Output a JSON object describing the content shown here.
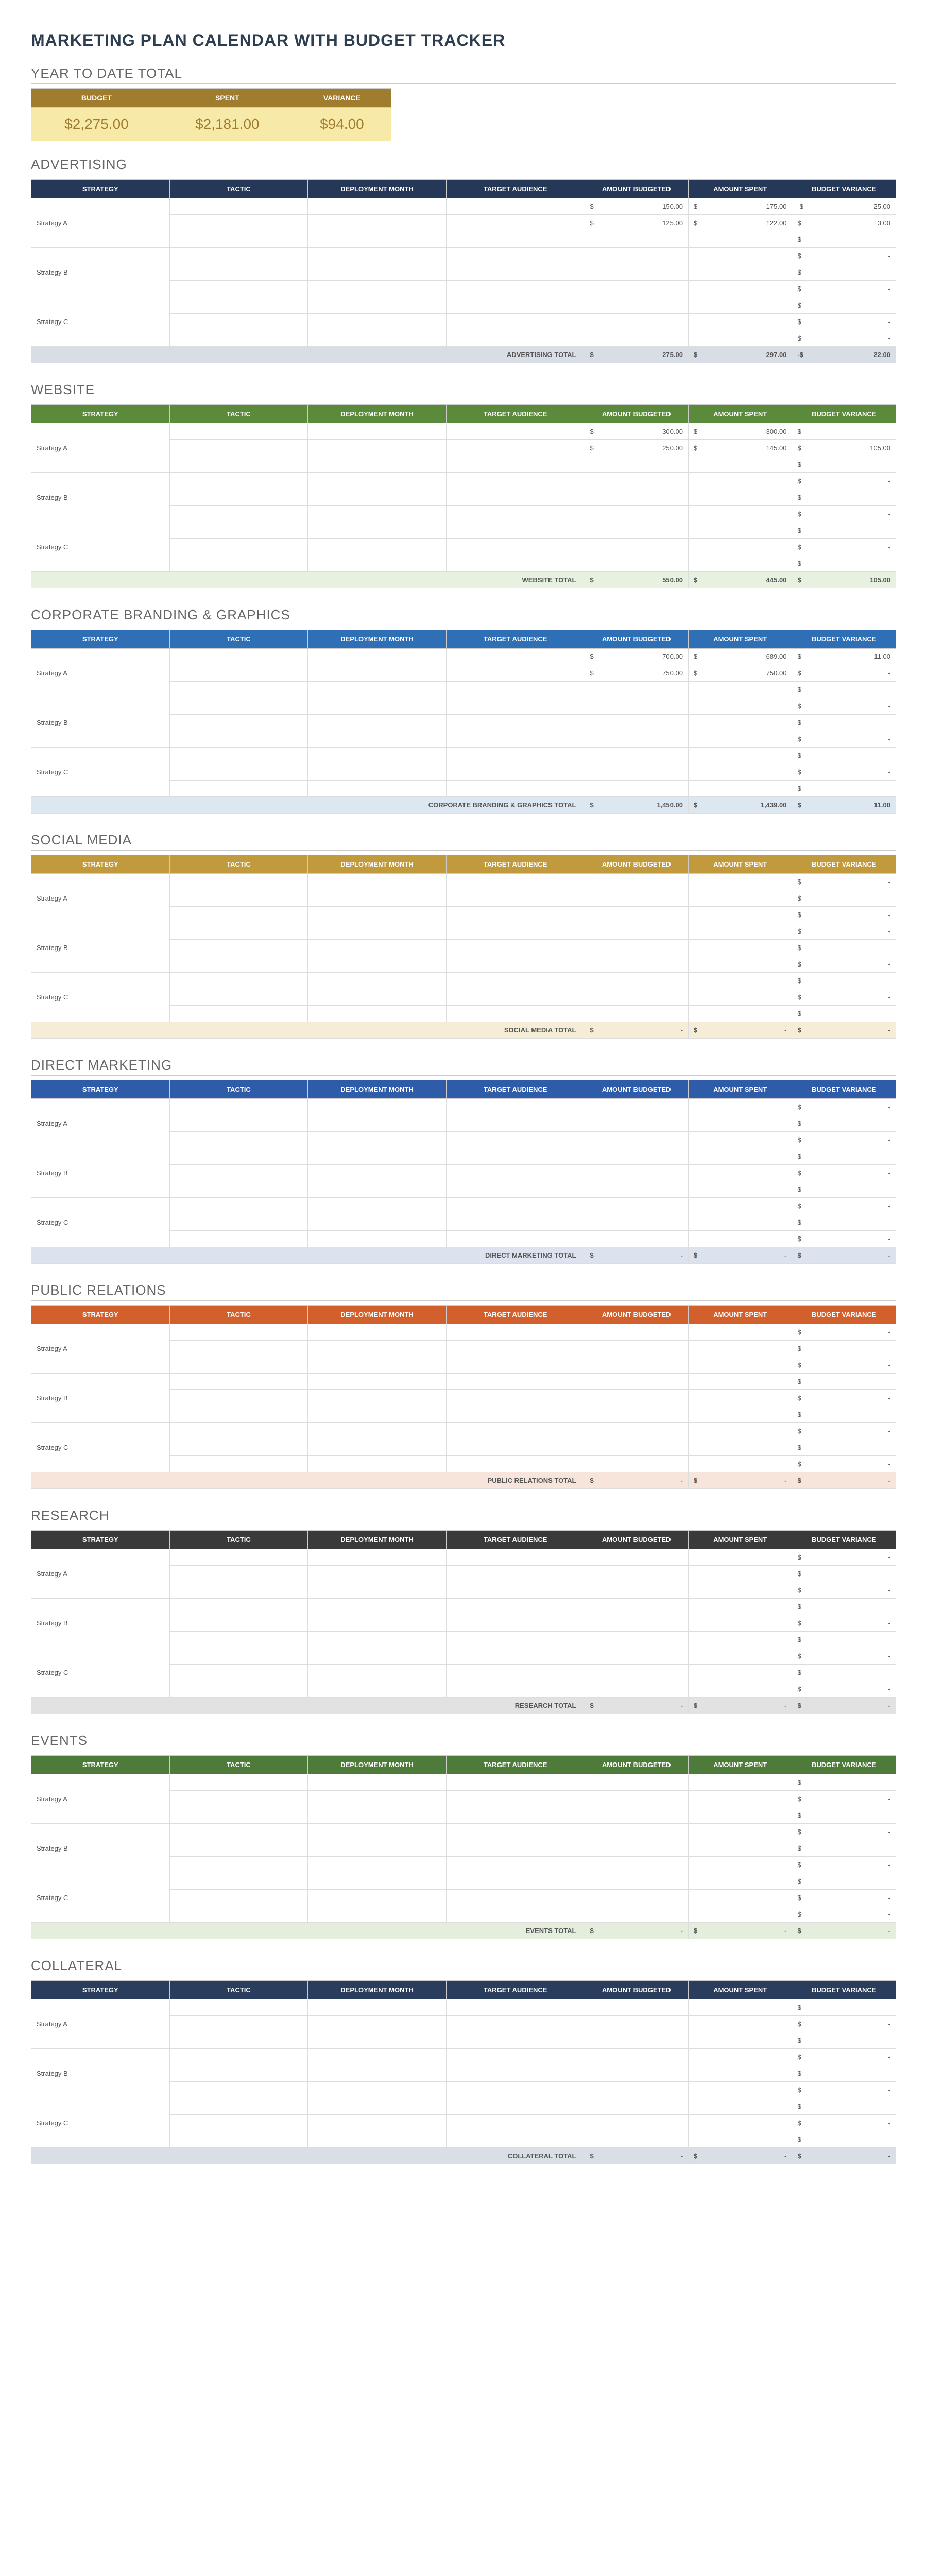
{
  "title": "MARKETING PLAN CALENDAR WITH BUDGET TRACKER",
  "ytd": {
    "heading": "YEAR TO DATE TOTAL",
    "headers": [
      "BUDGET",
      "SPENT",
      "VARIANCE"
    ],
    "values": [
      "$2,275.00",
      "$2,181.00",
      "$94.00"
    ]
  },
  "columns": [
    "STRATEGY",
    "TACTIC",
    "DEPLOYMENT MONTH",
    "TARGET AUDIENCE",
    "AMOUNT BUDGETED",
    "AMOUNT SPENT",
    "BUDGET VARIANCE"
  ],
  "dash": "-",
  "currency": "$",
  "sections": [
    {
      "id": "advertising",
      "title": "ADVERTISING",
      "hdr": "hdr-navy",
      "tot": "total-navy",
      "total_label": "ADVERTISING TOTAL",
      "total": {
        "budget": "275.00",
        "spent": "297.00",
        "variance_prefix": "-$",
        "variance": "22.00"
      },
      "groups": [
        {
          "strategy": "Strategy A",
          "rows": [
            {
              "budget": "150.00",
              "spent": "175.00",
              "variance_prefix": "-$",
              "variance": "25.00"
            },
            {
              "budget": "125.00",
              "spent": "122.00",
              "variance_prefix": "$",
              "variance": "3.00"
            },
            {
              "variance_prefix": "$",
              "variance": "-"
            }
          ]
        },
        {
          "strategy": "Strategy B",
          "rows": [
            {
              "variance_prefix": "$",
              "variance": "-"
            },
            {
              "variance_prefix": "$",
              "variance": "-"
            },
            {
              "variance_prefix": "$",
              "variance": "-"
            }
          ]
        },
        {
          "strategy": "Strategy C",
          "rows": [
            {
              "variance_prefix": "$",
              "variance": "-"
            },
            {
              "variance_prefix": "$",
              "variance": "-"
            },
            {
              "variance_prefix": "$",
              "variance": "-"
            }
          ]
        }
      ]
    },
    {
      "id": "website",
      "title": "WEBSITE",
      "hdr": "hdr-green",
      "tot": "total-green",
      "total_label": "WEBSITE TOTAL",
      "total": {
        "budget": "550.00",
        "spent": "445.00",
        "variance_prefix": "$",
        "variance": "105.00"
      },
      "groups": [
        {
          "strategy": "Strategy A",
          "rows": [
            {
              "budget": "300.00",
              "spent": "300.00",
              "variance_prefix": "$",
              "variance": "-"
            },
            {
              "budget": "250.00",
              "spent": "145.00",
              "variance_prefix": "$",
              "variance": "105.00"
            },
            {
              "variance_prefix": "$",
              "variance": "-"
            }
          ]
        },
        {
          "strategy": "Strategy B",
          "rows": [
            {
              "variance_prefix": "$",
              "variance": "-"
            },
            {
              "variance_prefix": "$",
              "variance": "-"
            },
            {
              "variance_prefix": "$",
              "variance": "-"
            }
          ]
        },
        {
          "strategy": "Strategy C",
          "rows": [
            {
              "variance_prefix": "$",
              "variance": "-"
            },
            {
              "variance_prefix": "$",
              "variance": "-"
            },
            {
              "variance_prefix": "$",
              "variance": "-"
            }
          ]
        }
      ]
    },
    {
      "id": "branding",
      "title": "CORPORATE BRANDING & GRAPHICS",
      "hdr": "hdr-blue",
      "tot": "total-blue",
      "total_label": "CORPORATE BRANDING & GRAPHICS TOTAL",
      "total": {
        "budget": "1,450.00",
        "spent": "1,439.00",
        "variance_prefix": "$",
        "variance": "11.00"
      },
      "groups": [
        {
          "strategy": "Strategy A",
          "rows": [
            {
              "budget": "700.00",
              "spent": "689.00",
              "variance_prefix": "$",
              "variance": "11.00"
            },
            {
              "budget": "750.00",
              "spent": "750.00",
              "variance_prefix": "$",
              "variance": "-"
            },
            {
              "variance_prefix": "$",
              "variance": "-"
            }
          ]
        },
        {
          "strategy": "Strategy B",
          "rows": [
            {
              "variance_prefix": "$",
              "variance": "-"
            },
            {
              "variance_prefix": "$",
              "variance": "-"
            },
            {
              "variance_prefix": "$",
              "variance": "-"
            }
          ]
        },
        {
          "strategy": "Strategy C",
          "rows": [
            {
              "variance_prefix": "$",
              "variance": "-"
            },
            {
              "variance_prefix": "$",
              "variance": "-"
            },
            {
              "variance_prefix": "$",
              "variance": "-"
            }
          ]
        }
      ]
    },
    {
      "id": "social",
      "title": "SOCIAL MEDIA",
      "hdr": "hdr-gold",
      "tot": "total-gold",
      "total_label": "SOCIAL MEDIA TOTAL",
      "total": {
        "budget": "-",
        "spent": "-",
        "variance_prefix": "$",
        "variance": "-"
      },
      "groups": [
        {
          "strategy": "Strategy A",
          "rows": [
            {
              "variance_prefix": "$",
              "variance": "-"
            },
            {
              "variance_prefix": "$",
              "variance": "-"
            },
            {
              "variance_prefix": "$",
              "variance": "-"
            }
          ]
        },
        {
          "strategy": "Strategy B",
          "rows": [
            {
              "variance_prefix": "$",
              "variance": "-"
            },
            {
              "variance_prefix": "$",
              "variance": "-"
            },
            {
              "variance_prefix": "$",
              "variance": "-"
            }
          ]
        },
        {
          "strategy": "Strategy C",
          "rows": [
            {
              "variance_prefix": "$",
              "variance": "-"
            },
            {
              "variance_prefix": "$",
              "variance": "-"
            },
            {
              "variance_prefix": "$",
              "variance": "-"
            }
          ]
        }
      ]
    },
    {
      "id": "direct",
      "title": "DIRECT MARKETING",
      "hdr": "hdr-blue2",
      "tot": "total-blue2",
      "total_label": "DIRECT MARKETING TOTAL",
      "total": {
        "budget": "-",
        "spent": "-",
        "variance_prefix": "$",
        "variance": "-"
      },
      "groups": [
        {
          "strategy": "Strategy A",
          "rows": [
            {
              "variance_prefix": "$",
              "variance": "-"
            },
            {
              "variance_prefix": "$",
              "variance": "-"
            },
            {
              "variance_prefix": "$",
              "variance": "-"
            }
          ]
        },
        {
          "strategy": "Strategy B",
          "rows": [
            {
              "variance_prefix": "$",
              "variance": "-"
            },
            {
              "variance_prefix": "$",
              "variance": "-"
            },
            {
              "variance_prefix": "$",
              "variance": "-"
            }
          ]
        },
        {
          "strategy": "Strategy C",
          "rows": [
            {
              "variance_prefix": "$",
              "variance": "-"
            },
            {
              "variance_prefix": "$",
              "variance": "-"
            },
            {
              "variance_prefix": "$",
              "variance": "-"
            }
          ]
        }
      ]
    },
    {
      "id": "pr",
      "title": "PUBLIC RELATIONS",
      "hdr": "hdr-orange",
      "tot": "total-orange",
      "total_label": "PUBLIC RELATIONS TOTAL",
      "total": {
        "budget": "-",
        "spent": "-",
        "variance_prefix": "$",
        "variance": "-"
      },
      "groups": [
        {
          "strategy": "Strategy A",
          "rows": [
            {
              "variance_prefix": "$",
              "variance": "-"
            },
            {
              "variance_prefix": "$",
              "variance": "-"
            },
            {
              "variance_prefix": "$",
              "variance": "-"
            }
          ]
        },
        {
          "strategy": "Strategy B",
          "rows": [
            {
              "variance_prefix": "$",
              "variance": "-"
            },
            {
              "variance_prefix": "$",
              "variance": "-"
            },
            {
              "variance_prefix": "$",
              "variance": "-"
            }
          ]
        },
        {
          "strategy": "Strategy C",
          "rows": [
            {
              "variance_prefix": "$",
              "variance": "-"
            },
            {
              "variance_prefix": "$",
              "variance": "-"
            },
            {
              "variance_prefix": "$",
              "variance": "-"
            }
          ]
        }
      ]
    },
    {
      "id": "research",
      "title": "RESEARCH",
      "hdr": "hdr-dark",
      "tot": "total-dark",
      "total_label": "RESEARCH TOTAL",
      "total": {
        "budget": "-",
        "spent": "-",
        "variance_prefix": "$",
        "variance": "-"
      },
      "groups": [
        {
          "strategy": "Strategy A",
          "rows": [
            {
              "variance_prefix": "$",
              "variance": "-"
            },
            {
              "variance_prefix": "$",
              "variance": "-"
            },
            {
              "variance_prefix": "$",
              "variance": "-"
            }
          ]
        },
        {
          "strategy": "Strategy B",
          "rows": [
            {
              "variance_prefix": "$",
              "variance": "-"
            },
            {
              "variance_prefix": "$",
              "variance": "-"
            },
            {
              "variance_prefix": "$",
              "variance": "-"
            }
          ]
        },
        {
          "strategy": "Strategy C",
          "rows": [
            {
              "variance_prefix": "$",
              "variance": "-"
            },
            {
              "variance_prefix": "$",
              "variance": "-"
            },
            {
              "variance_prefix": "$",
              "variance": "-"
            }
          ]
        }
      ]
    },
    {
      "id": "events",
      "title": "EVENTS",
      "hdr": "hdr-green2",
      "tot": "total-green2",
      "total_label": "EVENTS TOTAL",
      "total": {
        "budget": "-",
        "spent": "-",
        "variance_prefix": "$",
        "variance": "-"
      },
      "groups": [
        {
          "strategy": "Strategy A",
          "rows": [
            {
              "variance_prefix": "$",
              "variance": "-"
            },
            {
              "variance_prefix": "$",
              "variance": "-"
            },
            {
              "variance_prefix": "$",
              "variance": "-"
            }
          ]
        },
        {
          "strategy": "Strategy B",
          "rows": [
            {
              "variance_prefix": "$",
              "variance": "-"
            },
            {
              "variance_prefix": "$",
              "variance": "-"
            },
            {
              "variance_prefix": "$",
              "variance": "-"
            }
          ]
        },
        {
          "strategy": "Strategy C",
          "rows": [
            {
              "variance_prefix": "$",
              "variance": "-"
            },
            {
              "variance_prefix": "$",
              "variance": "-"
            },
            {
              "variance_prefix": "$",
              "variance": "-"
            }
          ]
        }
      ]
    },
    {
      "id": "collateral",
      "title": "COLLATERAL",
      "hdr": "hdr-navy2",
      "tot": "total-navy2",
      "total_label": "COLLATERAL TOTAL",
      "total": {
        "budget": "-",
        "spent": "-",
        "variance_prefix": "$",
        "variance": "-"
      },
      "groups": [
        {
          "strategy": "Strategy A",
          "rows": [
            {
              "variance_prefix": "$",
              "variance": "-"
            },
            {
              "variance_prefix": "$",
              "variance": "-"
            },
            {
              "variance_prefix": "$",
              "variance": "-"
            }
          ]
        },
        {
          "strategy": "Strategy B",
          "rows": [
            {
              "variance_prefix": "$",
              "variance": "-"
            },
            {
              "variance_prefix": "$",
              "variance": "-"
            },
            {
              "variance_prefix": "$",
              "variance": "-"
            }
          ]
        },
        {
          "strategy": "Strategy C",
          "rows": [
            {
              "variance_prefix": "$",
              "variance": "-"
            },
            {
              "variance_prefix": "$",
              "variance": "-"
            },
            {
              "variance_prefix": "$",
              "variance": "-"
            }
          ]
        }
      ]
    }
  ]
}
